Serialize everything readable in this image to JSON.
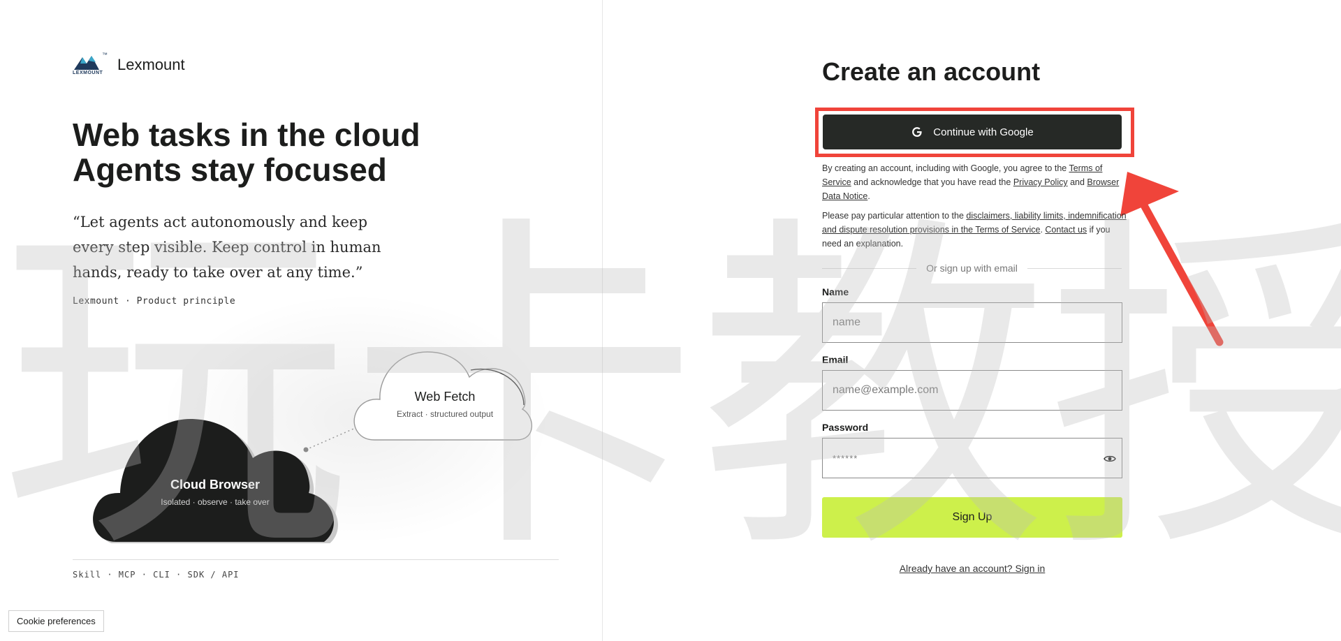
{
  "watermark": {
    "chars": [
      "玩",
      "卡",
      "教",
      "授"
    ]
  },
  "brand": {
    "name": "Lexmount",
    "logo_text": "LEXMOUNT",
    "logo_mark": "™"
  },
  "hero": {
    "line1": "Web tasks in the cloud",
    "line2": "Agents stay focused",
    "quote": "“Let agents act autonomously and keep every step visible. Keep control in human hands, ready to take over at any time.”",
    "attribution": "Lexmount · Product principle"
  },
  "illustration": {
    "cloud_browser": {
      "title": "Cloud Browser",
      "subtitle": "Isolated · observe · take over"
    },
    "web_fetch": {
      "title": "Web Fetch",
      "subtitle": "Extract · structured output"
    }
  },
  "footer": {
    "links": "Skill · MCP · CLI · SDK / API"
  },
  "cookie": {
    "label": "Cookie preferences"
  },
  "form": {
    "title": "Create an account",
    "google_label": "Continue with Google",
    "legal1": {
      "p1": "By creating an account, including with Google, you agree to the ",
      "terms": "Terms of Service",
      "p2": " and acknowledge that you have read the ",
      "privacy": "Privacy Policy",
      "p3": " and ",
      "browser": "Browser Data Notice",
      "p4": "."
    },
    "legal2": {
      "p1": "Please pay particular attention to the ",
      "disclaimers": "disclaimers, liability limits, indemnification and dispute resolution provisions in the Terms of Service",
      "p2": ". ",
      "contact": "Contact us",
      "p3": " if you need an explanation."
    },
    "divider": "Or sign up with email",
    "name": {
      "label": "Name",
      "placeholder": "name"
    },
    "email": {
      "label": "Email",
      "placeholder": "name@example.com"
    },
    "password": {
      "label": "Password",
      "placeholder": "******"
    },
    "signup_label": "Sign Up",
    "signin_label": "Already have an account? Sign in"
  },
  "colors": {
    "accent": "#cdf04b",
    "dark": "#262926",
    "annotation": "#f0443a"
  }
}
